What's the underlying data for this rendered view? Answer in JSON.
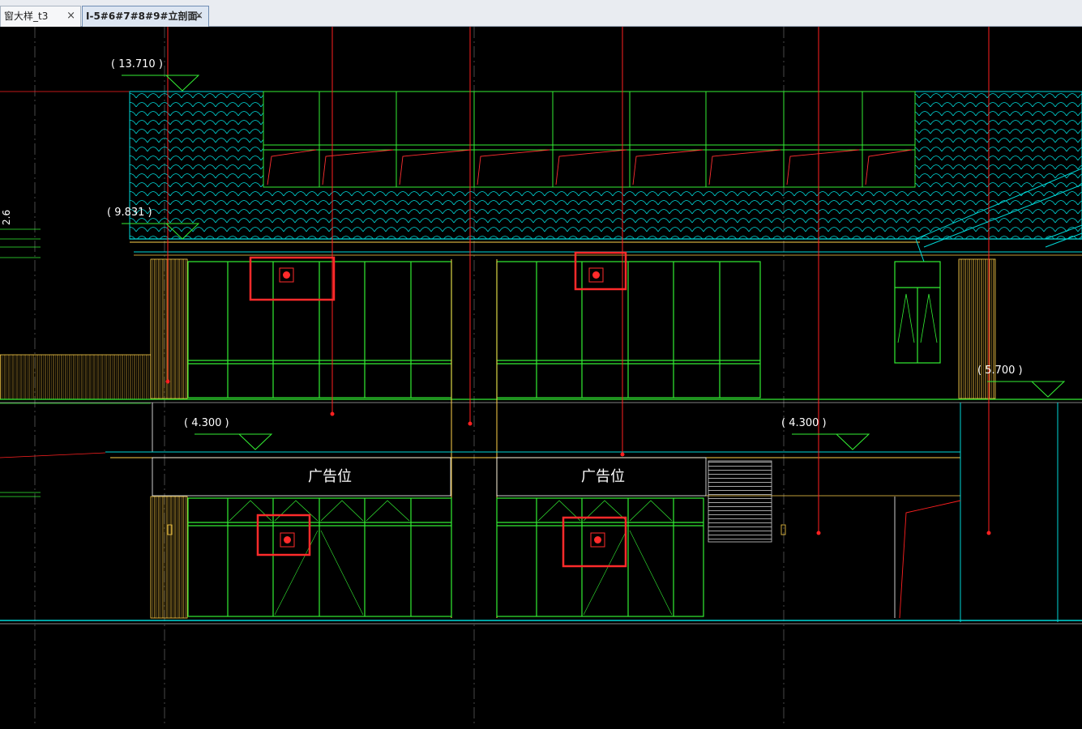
{
  "tabs": [
    {
      "label": "窗大样_t3",
      "close": "×"
    },
    {
      "label": "I-5#6#7#8#9#立剖面-",
      "close": "×"
    }
  ],
  "drawing": {
    "elevations": [
      "( 13.710 )",
      "( 9.831 )",
      "( 4.300 )",
      "( 4.300 )",
      "( 5.700 )"
    ],
    "side_dim": "2.6",
    "signs": [
      "广告位",
      "广告位"
    ],
    "colors": {
      "background": "#000000",
      "green": "#33ee33",
      "cyan": "#00dddd",
      "red": "#ff2020",
      "yellow": "#ffd24a",
      "highlight": "#ff2b2b"
    }
  }
}
